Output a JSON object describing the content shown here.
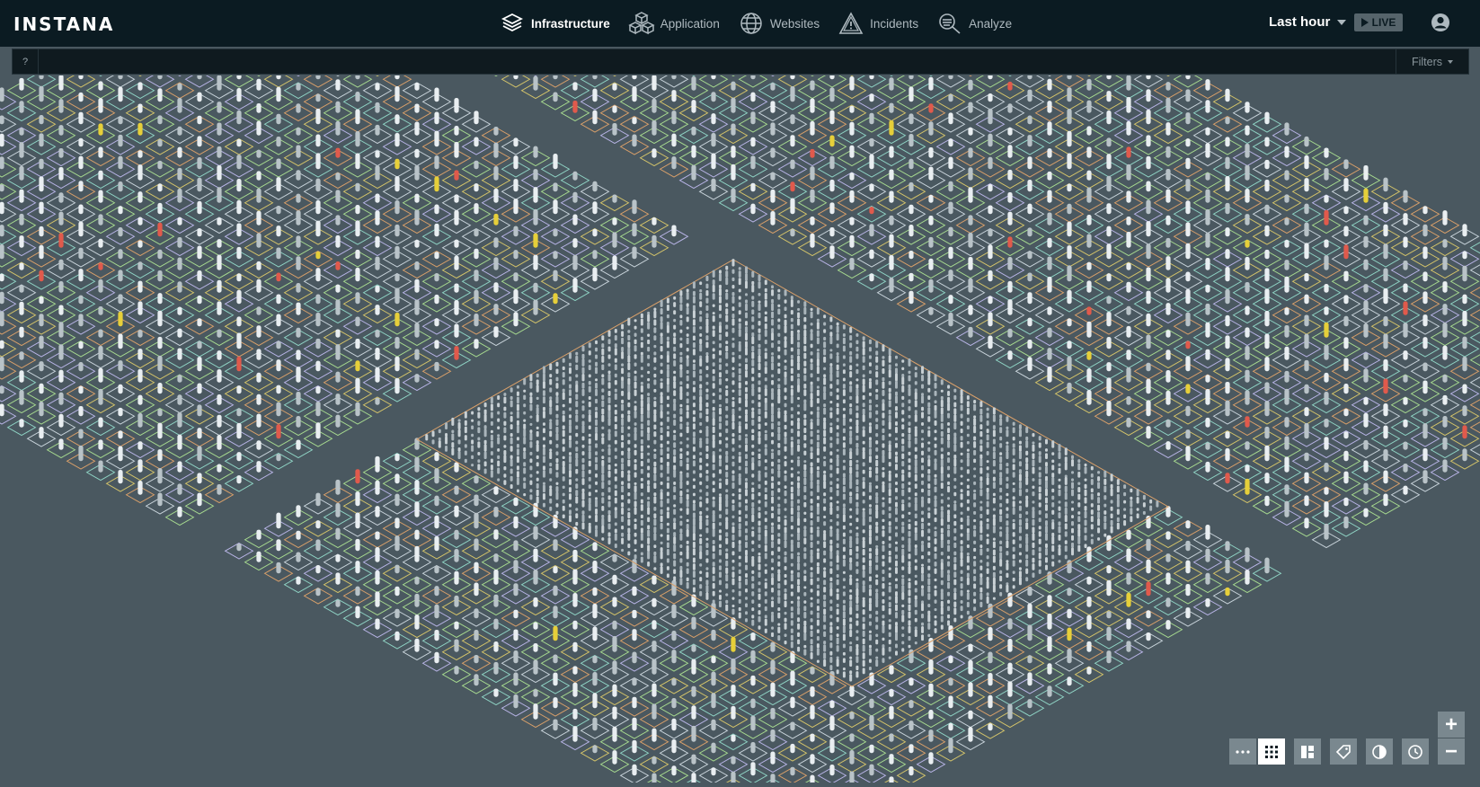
{
  "app": {
    "logo_text": "INSTANA"
  },
  "nav": {
    "items": [
      {
        "label": "Infrastructure",
        "icon": "infrastructure-stack-icon",
        "active": true
      },
      {
        "label": "Application",
        "icon": "application-cubes-icon",
        "active": false
      },
      {
        "label": "Websites",
        "icon": "globe-icon",
        "active": false
      },
      {
        "label": "Incidents",
        "icon": "warning-triangle-icon",
        "active": false
      },
      {
        "label": "Analyze",
        "icon": "analyze-magnifier-icon",
        "active": false
      }
    ]
  },
  "timeframe": {
    "label": "Last hour"
  },
  "live": {
    "label": "LIVE"
  },
  "search": {
    "help_label": "?",
    "value": "",
    "filters_label": "Filters"
  },
  "map_controls": {
    "buttons": [
      {
        "name": "more-options-icon",
        "active": false
      },
      {
        "name": "grid-layout-icon",
        "active": true
      },
      {
        "name": "group-layout-icon",
        "active": false
      },
      {
        "name": "tag-icon",
        "active": false
      },
      {
        "name": "color-by-icon",
        "active": false
      },
      {
        "name": "clock-icon",
        "active": false
      }
    ],
    "zoom_in": "+",
    "zoom_out": "−"
  },
  "colors": {
    "header_bg": "#0b1b22",
    "map_bg": "#4a5860",
    "tile_outlines": [
      "#a6d98f",
      "#8fd3c4",
      "#b8b4e6",
      "#d4c46a",
      "#c9d4db",
      "#d9a06a"
    ],
    "status_warning": "#e6cf3a",
    "status_critical": "#e05a4c",
    "host_pillar": "#e9eef1",
    "cluster_outline": "#d9a06a"
  }
}
